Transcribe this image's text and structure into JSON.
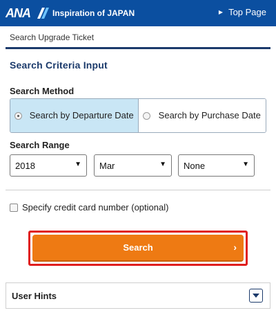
{
  "header": {
    "logo_text": "ANA",
    "tagline": "Inspiration of JAPAN",
    "top_link": "Top Page",
    "color": "#0b4fa0"
  },
  "breadcrumb": "Search Upgrade Ticket",
  "form": {
    "title": "Search Criteria Input",
    "method": {
      "label": "Search Method",
      "options": [
        {
          "label": "Search by Departure Date",
          "selected": true
        },
        {
          "label": "Search by Purchase Date",
          "selected": false
        }
      ]
    },
    "range": {
      "label": "Search Range",
      "year": "2018",
      "month": "Mar",
      "day": "None"
    },
    "credit_card": {
      "label": "Specify credit card number (optional)",
      "checked": false
    },
    "search_button": {
      "label": "Search",
      "color": "#ee7a13",
      "highlight": "#e01e1e"
    }
  },
  "hints": {
    "label": "User Hints"
  },
  "icons": {
    "top_link": "triangle-right-icon",
    "select": "triangle-down-icon",
    "search": "chevron-right-icon",
    "hints": "dropdown-toggle-icon"
  }
}
